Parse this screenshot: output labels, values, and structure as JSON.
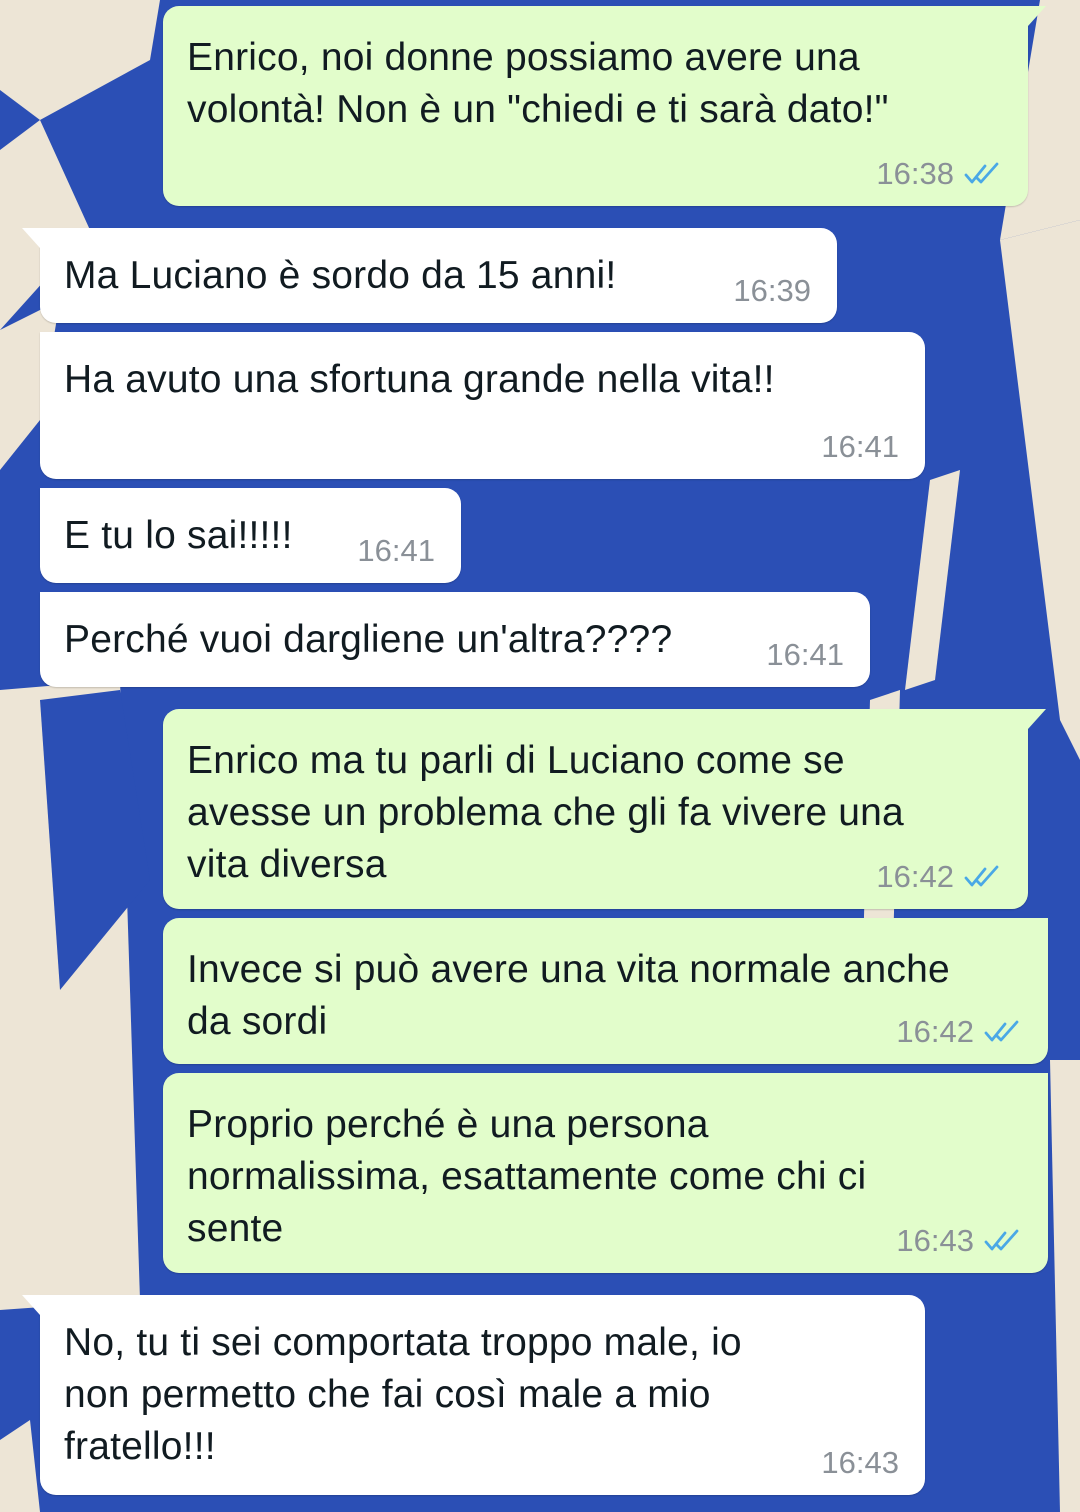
{
  "colors": {
    "wallpaper_blue": "#2b4fb5",
    "wallpaper_cream": "#ede5d6",
    "outgoing_bubble": "#e2fdcb",
    "incoming_bubble": "#ffffff",
    "timestamp": "#8a9097",
    "read_receipt": "#4aa8e6"
  },
  "messages": [
    {
      "direction": "out",
      "text": "Enrico, noi donne possiamo avere una\nvolontà! Non è un \"chiedi e ti sarà dato!\"",
      "time": "16:38",
      "status_icon": "double-check-read-icon"
    },
    {
      "direction": "in",
      "text": "Ma Luciano è sordo da 15 anni!",
      "time": "16:39"
    },
    {
      "direction": "in",
      "text": "Ha avuto una sfortuna grande nella vita!!",
      "time": "16:41"
    },
    {
      "direction": "in",
      "text": "E tu lo sai!!!!!",
      "time": "16:41"
    },
    {
      "direction": "in",
      "text": "Perché vuoi dargliene un'altra????",
      "time": "16:41"
    },
    {
      "direction": "out",
      "text": "Enrico ma tu parli di Luciano come se\navesse un problema che gli fa vivere una\nvita diversa",
      "time": "16:42",
      "status_icon": "double-check-read-icon"
    },
    {
      "direction": "out",
      "text": "Invece si può avere una vita normale anche\nda sordi",
      "time": "16:42",
      "status_icon": "double-check-read-icon"
    },
    {
      "direction": "out",
      "text": "Proprio perché è una persona\nnormalissima, esattamente come chi ci\nsente",
      "time": "16:43",
      "status_icon": "double-check-read-icon"
    },
    {
      "direction": "in",
      "text": "No, tu ti sei comportata troppo male, io\nnon permetto che fai così male a mio\nfratello!!!",
      "time": "16:43"
    }
  ]
}
